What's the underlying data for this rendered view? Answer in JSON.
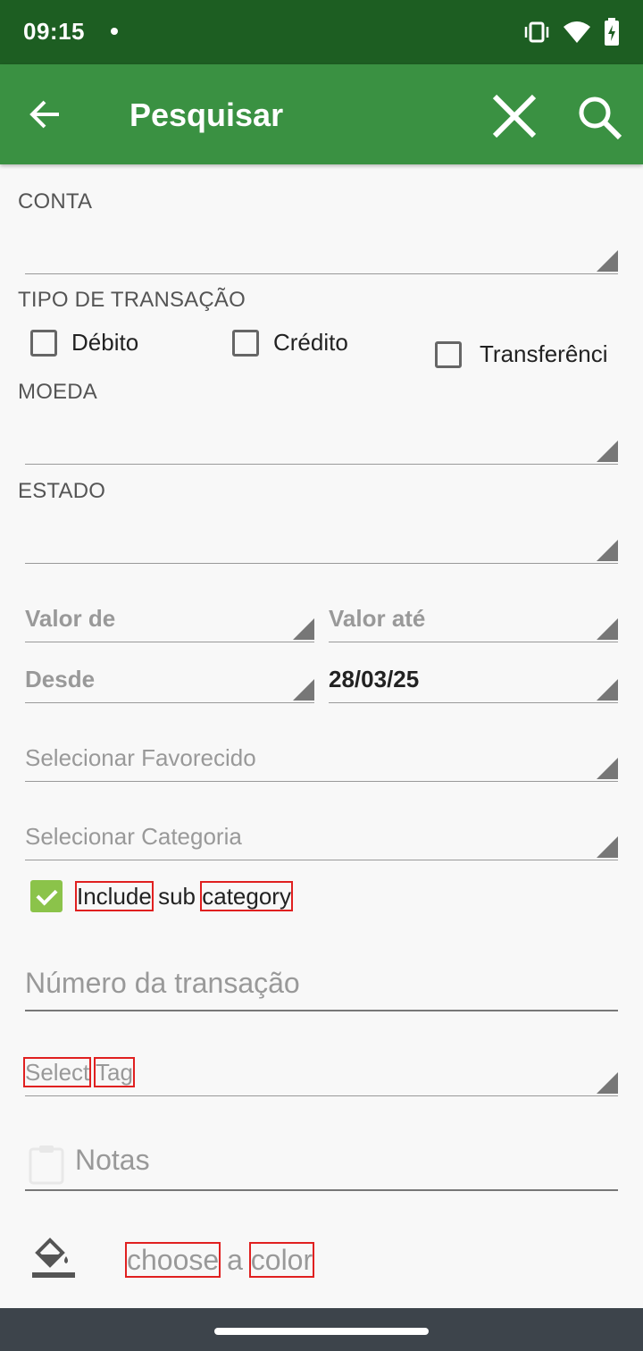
{
  "status": {
    "time": "09:15"
  },
  "appbar": {
    "title": "Pesquisar"
  },
  "form": {
    "conta_label": "CONTA",
    "tipo_label": "TIPO DE TRANSAÇÃO",
    "tipo_options": [
      "Débito",
      "Crédito",
      "Transferênci"
    ],
    "moeda_label": "MOEDA",
    "estado_label": "ESTADO",
    "valor_de": "Valor de",
    "valor_ate": "Valor até",
    "desde": "Desde",
    "date_value": "28/03/25",
    "favorecido_placeholder": "Selecionar Favorecido",
    "categoria_placeholder": "Selecionar Categoria",
    "include_sub": {
      "include": "Include",
      "sub": "sub",
      "category": "category",
      "checked": true
    },
    "numero_placeholder": "Número da transação",
    "tag": {
      "select": "Select",
      "tag": "Tag"
    },
    "notas_placeholder": "Notas",
    "color": {
      "choose": "choose",
      "a": "a",
      "color": "color"
    }
  },
  "colors": {
    "statusbar": "#1d5e22",
    "appbar": "#3a9142",
    "checkbox_checked": "#8bc34a"
  }
}
